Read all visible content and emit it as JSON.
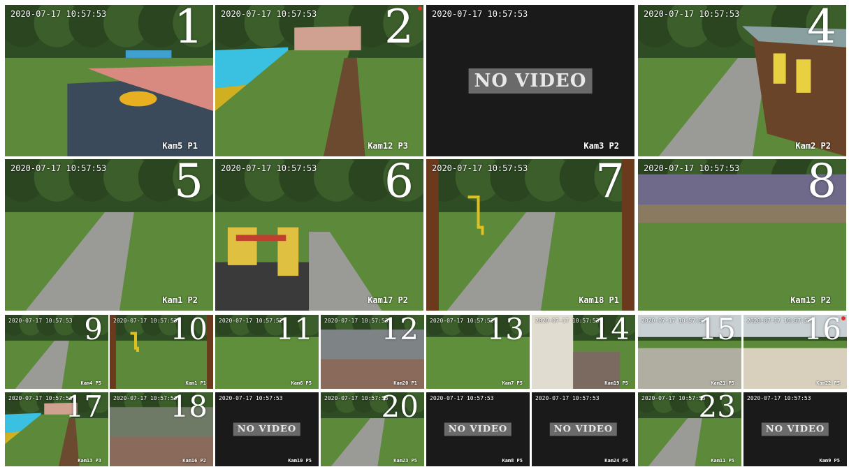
{
  "app": {
    "title": ""
  },
  "colors": {
    "background": "#ffffff",
    "tile_black": "#1a1a1a",
    "grass": "#5d8a3a",
    "path": "#9a9a96",
    "sky": "#c9d4dc",
    "novideo_bg": "#6a6a6a"
  },
  "large_tiles": [
    {
      "number": "1",
      "timestamp": "2020-07-17 10:57:53",
      "camera": "Kam5 P1",
      "scene": "playground-green",
      "no_video": false
    },
    {
      "number": "2",
      "timestamp": "2020-07-17 10:57:53",
      "camera": "Kam12 P3",
      "scene": "playground-blue",
      "no_video": false,
      "rec": true
    },
    {
      "number": "",
      "timestamp": "2020-07-17 10:57:53",
      "camera": "Kam3 P2",
      "scene": "black",
      "no_video": true,
      "no_video_label": "NO VIDEO"
    },
    {
      "number": "4",
      "timestamp": "2020-07-17 10:57:53",
      "camera": "Kam2 P2",
      "scene": "kiosk",
      "no_video": false
    },
    {
      "number": "5",
      "timestamp": "2020-07-17 10:57:53",
      "camera": "Kam1 P2",
      "scene": "path",
      "no_video": false
    },
    {
      "number": "6",
      "timestamp": "2020-07-17 10:57:53",
      "camera": "Kam17 P2",
      "scene": "playground-yellow",
      "no_video": false
    },
    {
      "number": "7",
      "timestamp": "2020-07-17 10:57:53",
      "camera": "Kam18 P1",
      "scene": "path-fisheye",
      "no_video": false
    },
    {
      "number": "8",
      "timestamp": "2020-07-17 10:57:53",
      "camera": "Kam15 P2",
      "scene": "meadow",
      "no_video": false
    }
  ],
  "small_tiles": [
    {
      "number": "9",
      "timestamp": "2020-07-17 10:57:53",
      "camera": "Kam4 P5",
      "scene": "path",
      "no_video": false
    },
    {
      "number": "10",
      "timestamp": "2020-07-17 10:57:53",
      "camera": "Kam1 P1",
      "scene": "fisheye-grass",
      "no_video": false
    },
    {
      "number": "11",
      "timestamp": "2020-07-17 10:57:52",
      "camera": "Kam6 P5",
      "scene": "grass",
      "no_video": false
    },
    {
      "number": "12",
      "timestamp": "2020-07-17 10:57:53",
      "camera": "Kam20 P1",
      "scene": "pavement",
      "no_video": false
    },
    {
      "number": "13",
      "timestamp": "2020-07-17 10:57:53",
      "camera": "Kam7 P5",
      "scene": "grass",
      "no_video": false
    },
    {
      "number": "14",
      "timestamp": "2020-07-17 10:57:53",
      "camera": "Kam19 P5",
      "scene": "wall-path",
      "no_video": false
    },
    {
      "number": "15",
      "timestamp": "2020-07-17 10:57:53",
      "camera": "Kam21 P5",
      "scene": "sandpit",
      "no_video": false
    },
    {
      "number": "16",
      "timestamp": "2020-07-17 10:57:53",
      "camera": "Kam22 P5",
      "scene": "sandpit-light",
      "no_video": false,
      "rec": true
    },
    {
      "number": "17",
      "timestamp": "2020-07-17 10:57:53",
      "camera": "Kam13 P3",
      "scene": "playground-blue",
      "no_video": false
    },
    {
      "number": "18",
      "timestamp": "2020-07-17 10:57:53",
      "camera": "Kam16 P2",
      "scene": "pavement-dark",
      "no_video": false
    },
    {
      "number": "",
      "timestamp": "2020-07-17 10:57:53",
      "camera": "Kam10 P5",
      "scene": "black",
      "no_video": true,
      "no_video_label": "NO VIDEO"
    },
    {
      "number": "20",
      "timestamp": "2020-07-17 10:57:53",
      "camera": "Kam23 P5",
      "scene": "path",
      "no_video": false
    },
    {
      "number": "",
      "timestamp": "2020-07-17 10:57:53",
      "camera": "Kam8 P5",
      "scene": "black",
      "no_video": true,
      "no_video_label": "NO VIDEO"
    },
    {
      "number": "",
      "timestamp": "2020-07-17 10:57:53",
      "camera": "Kam24 P5",
      "scene": "black",
      "no_video": true,
      "no_video_label": "NO VIDEO"
    },
    {
      "number": "23",
      "timestamp": "2020-07-17 10:57:53",
      "camera": "Kam11 P5",
      "scene": "path",
      "no_video": false
    },
    {
      "number": "",
      "timestamp": "2020-07-17 10:57:53",
      "camera": "Kam9 P5",
      "scene": "black",
      "no_video": true,
      "no_video_label": "NO VIDEO"
    }
  ]
}
